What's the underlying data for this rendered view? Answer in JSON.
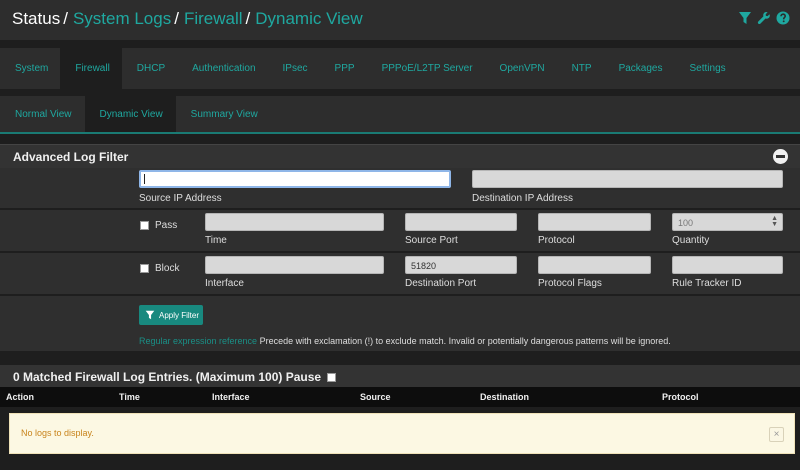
{
  "breadcrumb": {
    "root": "Status",
    "items": [
      "System Logs",
      "Firewall",
      "Dynamic View"
    ],
    "separator": "/"
  },
  "header_icons": [
    "filter-icon",
    "wrench-icon",
    "help-icon"
  ],
  "tabs_primary": [
    "System",
    "Firewall",
    "DHCP",
    "Authentication",
    "IPsec",
    "PPP",
    "PPPoE/L2TP Server",
    "OpenVPN",
    "NTP",
    "Packages",
    "Settings"
  ],
  "tabs_primary_active": "Firewall",
  "tabs_secondary": [
    "Normal View",
    "Dynamic View",
    "Summary View"
  ],
  "tabs_secondary_active": "Dynamic View",
  "filter": {
    "title": "Advanced Log Filter",
    "source_ip": {
      "label": "Source IP Address",
      "value": ""
    },
    "destination_ip": {
      "label": "Destination IP Address",
      "value": ""
    },
    "pass": {
      "label": "Pass",
      "checked": false
    },
    "block": {
      "label": "Block",
      "checked": false
    },
    "time": {
      "label": "Time",
      "value": ""
    },
    "source_port": {
      "label": "Source Port",
      "value": ""
    },
    "protocol": {
      "label": "Protocol",
      "value": ""
    },
    "quantity": {
      "label": "Quantity",
      "value": "100"
    },
    "interface": {
      "label": "Interface",
      "value": ""
    },
    "destination_port": {
      "label": "Destination Port",
      "value": "51820"
    },
    "protocol_flags": {
      "label": "Protocol Flags",
      "value": ""
    },
    "rule_tracker_id": {
      "label": "Rule Tracker ID",
      "value": ""
    },
    "apply_label": "Apply Filter",
    "hint_link": "Regular expression reference",
    "hint_text": "Precede with exclamation (!) to exclude match. Invalid or potentially dangerous patterns will be ignored."
  },
  "entries": {
    "title": "0 Matched Firewall Log Entries. (Maximum 100) Pause",
    "pause_checked": false,
    "columns": [
      "Action",
      "Time",
      "Interface",
      "Source",
      "Destination",
      "Protocol"
    ],
    "empty_message": "No logs to display.",
    "close_glyph": "×"
  },
  "colors": {
    "accent": "#1fa8a0",
    "button": "#18897f",
    "alert_bg": "#fcf8e3",
    "alert_text": "#c8841c"
  }
}
